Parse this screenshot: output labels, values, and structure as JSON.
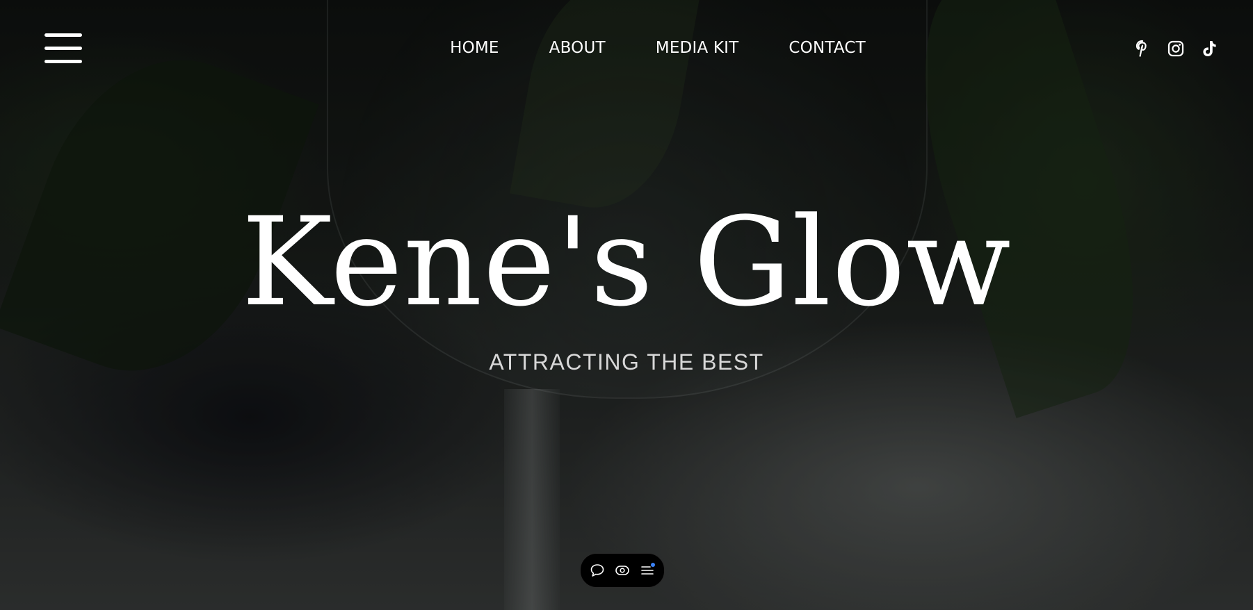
{
  "header": {
    "menu_icon": "hamburger-menu-icon",
    "nav": [
      {
        "label": "HOME"
      },
      {
        "label": "ABOUT"
      },
      {
        "label": "MEDIA KIT"
      },
      {
        "label": "CONTACT"
      }
    ],
    "social": [
      {
        "icon": "pinterest-icon"
      },
      {
        "icon": "instagram-icon"
      },
      {
        "icon": "tiktok-icon"
      }
    ]
  },
  "hero": {
    "title": "Kene's Glow",
    "subtitle": "ATTRACTING THE BEST"
  },
  "toolbar": {
    "items": [
      {
        "icon": "comment-icon"
      },
      {
        "icon": "preview-eye-icon"
      },
      {
        "icon": "list-menu-icon"
      }
    ],
    "notification_dot_color": "#3b82f6"
  },
  "colors": {
    "text": "#ffffff",
    "subtitle": "#d8d8d8",
    "toolbar_bg": "#000000"
  }
}
